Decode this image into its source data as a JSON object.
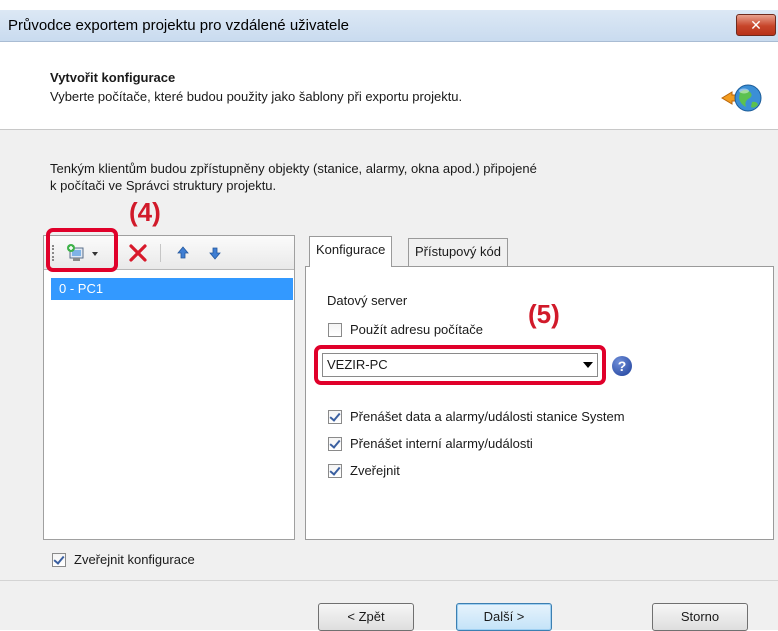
{
  "window": {
    "title": "Průvodce exportem projektu pro vzdálené uživatele",
    "close_symbol": "✕"
  },
  "header": {
    "title": "Vytvořit konfigurace",
    "subtitle": "Vyberte počítače, které budou použity jako šablony při exportu projektu.",
    "icon": "globe-export-icon"
  },
  "description": {
    "line1": "Tenkým klientům budou zpřístupněny objekty (stanice, alarmy, okna apod.) připojené",
    "line2": "k počítači ve Správci struktury projektu."
  },
  "toolbar": {
    "add_icon": "add-computer-icon",
    "delete_icon": "delete-icon",
    "up_icon": "arrow-up-icon",
    "down_icon": "arrow-down-icon"
  },
  "computer_list": {
    "items": [
      {
        "label": "0 - PC1",
        "selected": true
      }
    ]
  },
  "annotations": {
    "label_4": "(4)",
    "label_5": "(5)",
    "highlight_color": "#e0002a"
  },
  "tabs": [
    {
      "label": "Konfigurace",
      "active": true
    },
    {
      "label": "Přístupový kód",
      "active": false
    }
  ],
  "config": {
    "server_label": "Datový server",
    "use_address_label": "Použít adresu počítače",
    "use_address_checked": false,
    "server_value": "VEZIR-PC",
    "help_symbol": "?",
    "options": [
      {
        "label": "Přenášet data a alarmy/události stanice System",
        "checked": true
      },
      {
        "label": "Přenášet interní alarmy/události",
        "checked": true
      },
      {
        "label": "Zveřejnit",
        "checked": true
      }
    ]
  },
  "footer": {
    "publish_label": "Zveřejnit konfigurace",
    "publish_checked": true,
    "back_label": "< Zpět",
    "next_label": "Další >",
    "cancel_label": "Storno"
  }
}
